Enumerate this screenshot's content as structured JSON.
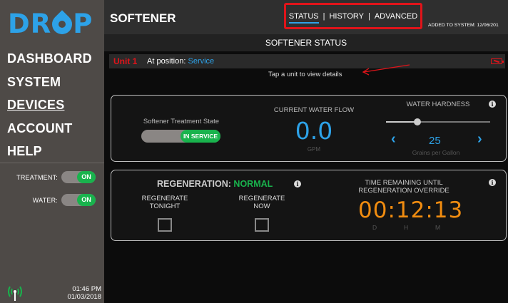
{
  "sidebar": {
    "logo": {
      "prefix": "DR",
      "suffix": "P"
    },
    "nav": [
      "DASHBOARD",
      "SYSTEM",
      "DEVICES",
      "ACCOUNT",
      "HELP"
    ],
    "active_nav": "DEVICES",
    "toggles": [
      {
        "label": "TREATMENT:",
        "state": "ON"
      },
      {
        "label": "WATER:",
        "state": "ON"
      }
    ],
    "clock": {
      "time": "01:46 PM",
      "date": "01/03/2018"
    },
    "colors": {
      "background": "#4e4a47",
      "brand": "#2da2e8",
      "on": "#19b34d"
    }
  },
  "header": {
    "title": "SOFTENER",
    "tabs": [
      "STATUS",
      "HISTORY",
      "ADVANCED"
    ],
    "active_tab": "STATUS",
    "separator": "|",
    "added_to_system": "ADDED TO SYSTEM: 12/06/201"
  },
  "status": {
    "title": "SOFTENER STATUS",
    "unit_name": "Unit 1",
    "position_label": "At position:",
    "position_value": "Service",
    "tap_hint": "Tap a unit to view details",
    "battery_icon": "battery-empty-icon"
  },
  "treatment": {
    "label": "Softener Treatment State",
    "state": "IN SERVICE"
  },
  "flow": {
    "label": "CURRENT WATER FLOW",
    "value": "0.0",
    "unit": "GPM"
  },
  "hardness": {
    "label": "WATER HARDNESS",
    "value": "25",
    "unit": "Grains per Gallon",
    "slider_fraction": 0.3,
    "left_chevron": "‹",
    "right_chevron": "›",
    "info_icon": "i"
  },
  "regeneration": {
    "title": "REGENERATION:",
    "state": "NORMAL",
    "tonight_label_1": "REGENERATE",
    "tonight_label_2": "TONIGHT",
    "now_label_1": "REGENERATE",
    "now_label_2": "NOW",
    "info_icon": "i"
  },
  "override": {
    "label_1": "TIME REMAINING UNTIL",
    "label_2": "REGENERATION OVERRIDE",
    "timer": "00:12:13",
    "units": [
      "D",
      "H",
      "M"
    ],
    "info_icon": "i"
  }
}
